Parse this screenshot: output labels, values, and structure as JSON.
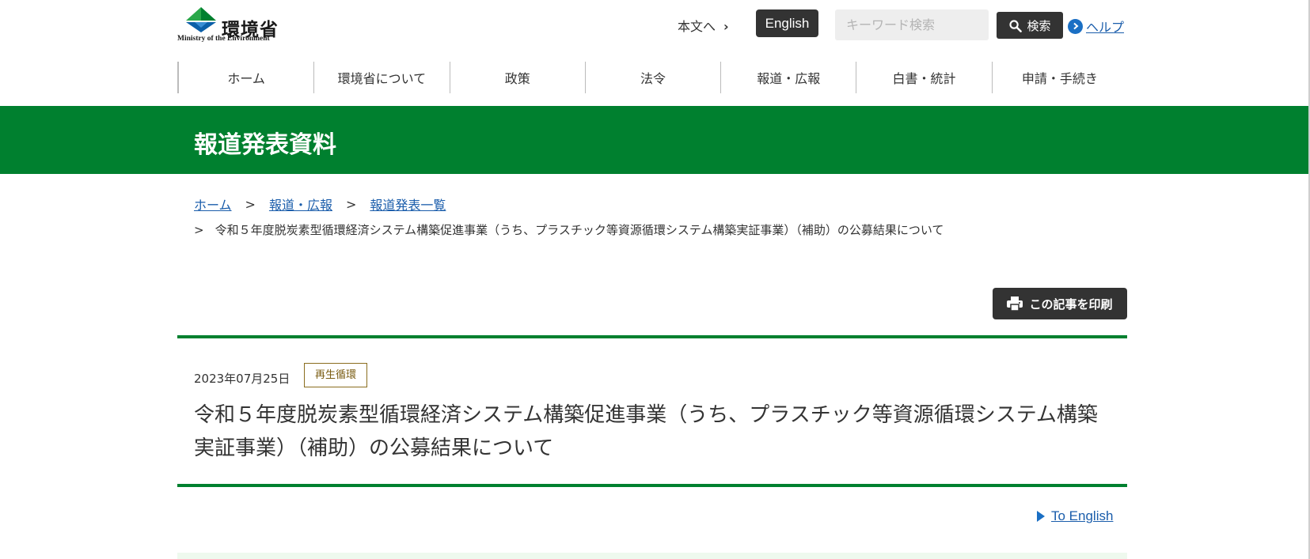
{
  "header": {
    "logo_jp": "環境省",
    "logo_en": "Ministry of the Environment",
    "logo_icon": "moe-logo-icon",
    "skip_label": "本文へ",
    "english_label": "English",
    "search": {
      "placeholder": "キーワード検索",
      "value": "",
      "button_label": "検索",
      "button_icon": "search-icon"
    },
    "help_label": "ヘルプ",
    "help_icon": "chevron-right-circle-icon"
  },
  "nav": {
    "items": [
      {
        "label": "ホーム"
      },
      {
        "label": "環境省について"
      },
      {
        "label": "政策"
      },
      {
        "label": "法令"
      },
      {
        "label": "報道・広報"
      },
      {
        "label": "白書・統計"
      },
      {
        "label": "申請・手続き"
      }
    ]
  },
  "page": {
    "section_title": "報道発表資料"
  },
  "breadcrumb": {
    "items": [
      {
        "label": "ホーム"
      },
      {
        "label": "報道・広報"
      },
      {
        "label": "報道発表一覧"
      }
    ],
    "separator": ">",
    "current": "令和５年度脱炭素型循環経済システム構築促進事業（うち、プラスチック等資源循環システム構築実証事業）（補助）の公募結果について"
  },
  "print": {
    "label": "この記事を印刷",
    "icon": "printer-icon"
  },
  "article": {
    "date": "2023年07月25日",
    "tag": "再生循環",
    "title": "令和５年度脱炭素型循環経済システム構築促進事業（うち、プラスチック等資源循環システム構築実証事業）（補助）の公募結果について",
    "to_english": "To English"
  },
  "colors": {
    "brand_green": "#00802f",
    "dark_button": "#333333",
    "link_blue": "#1a5dab",
    "tag_border": "#8a6d1f"
  }
}
